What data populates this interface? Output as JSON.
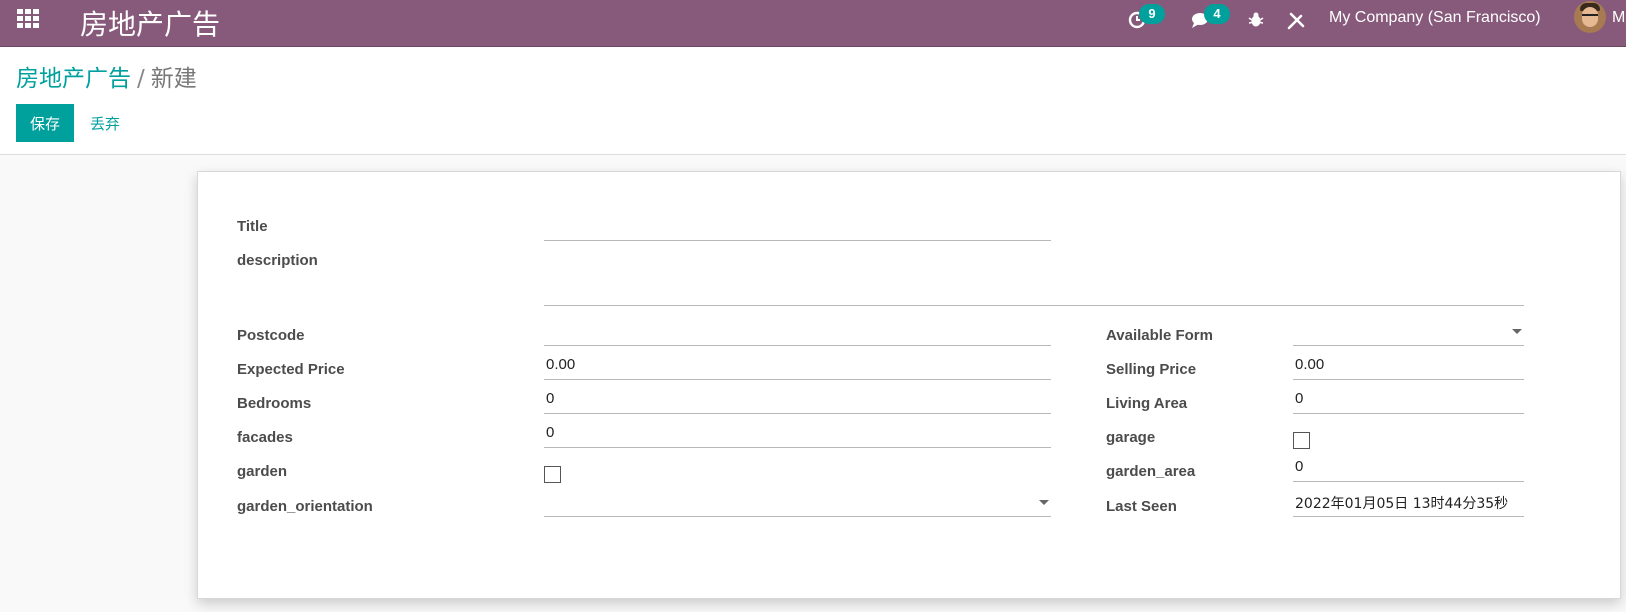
{
  "navbar": {
    "app_title": "房地产广告",
    "activity_count": "9",
    "messages_count": "4",
    "company": "My Company (San Francisco)",
    "user_name": "Mi"
  },
  "breadcrumb": {
    "parent": "房地产广告",
    "separator": "/",
    "current": "新建"
  },
  "actions": {
    "save_label": "保存",
    "discard_label": "丢弃"
  },
  "form": {
    "title": {
      "label": "Title",
      "value": ""
    },
    "description": {
      "label": "description",
      "value": ""
    },
    "postcode": {
      "label": "Postcode",
      "value": ""
    },
    "expected_price": {
      "label": "Expected Price",
      "value": "0.00"
    },
    "bedrooms": {
      "label": "Bedrooms",
      "value": "0"
    },
    "facades": {
      "label": "facades",
      "value": "0"
    },
    "garden": {
      "label": "garden",
      "checked": false
    },
    "garden_orientation": {
      "label": "garden_orientation",
      "value": ""
    },
    "available_form": {
      "label": "Available Form",
      "value": ""
    },
    "selling_price": {
      "label": "Selling Price",
      "value": "0.00"
    },
    "living_area": {
      "label": "Living Area",
      "value": "0"
    },
    "garage": {
      "label": "garage",
      "checked": false
    },
    "garden_area": {
      "label": "garden_area",
      "value": "0"
    },
    "last_seen": {
      "label": "Last Seen",
      "value": "2022年01月05日 13时44分35秒"
    }
  },
  "colors": {
    "navbar": "#875a7b",
    "accent": "#00a09d"
  }
}
